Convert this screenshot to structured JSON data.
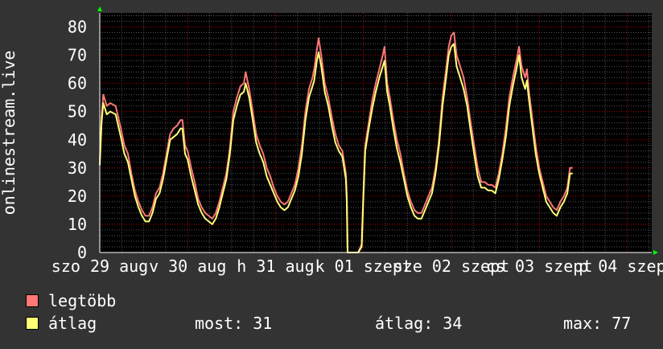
{
  "chart_data": {
    "type": "line",
    "ylabel": "onlinestream.live",
    "ylim": [
      0,
      85
    ],
    "yticks": [
      0,
      10,
      20,
      30,
      40,
      50,
      60,
      70,
      80
    ],
    "xticks": [
      {
        "label": "szo 29 aug",
        "day": 0
      },
      {
        "label": "v 30 aug",
        "day": 1
      },
      {
        "label": "h 31 aug",
        "day": 2
      },
      {
        "label": "k 01 szept",
        "day": 3
      },
      {
        "label": "sze 02 szept",
        "day": 4
      },
      {
        "label": "cs 03 szept",
        "day": 5
      },
      {
        "label": "p 04 szept",
        "day": 6
      }
    ],
    "xlim_days": [
      0,
      6.28
    ],
    "grid": true,
    "series": [
      {
        "name": "legtöbb",
        "color": "#ff7777",
        "points": [
          [
            0.0,
            33
          ],
          [
            0.02,
            48
          ],
          [
            0.04,
            56
          ],
          [
            0.08,
            52
          ],
          [
            0.12,
            53
          ],
          [
            0.18,
            52
          ],
          [
            0.24,
            44
          ],
          [
            0.28,
            38
          ],
          [
            0.32,
            35
          ],
          [
            0.36,
            28
          ],
          [
            0.4,
            22
          ],
          [
            0.44,
            18
          ],
          [
            0.48,
            15
          ],
          [
            0.52,
            13
          ],
          [
            0.56,
            13
          ],
          [
            0.6,
            16
          ],
          [
            0.64,
            21
          ],
          [
            0.68,
            23
          ],
          [
            0.72,
            28
          ],
          [
            0.76,
            35
          ],
          [
            0.8,
            42
          ],
          [
            0.84,
            44
          ],
          [
            0.88,
            45
          ],
          [
            0.92,
            47
          ],
          [
            0.94,
            47
          ],
          [
            0.97,
            38
          ],
          [
            1.0,
            36
          ],
          [
            1.04,
            30
          ],
          [
            1.08,
            25
          ],
          [
            1.12,
            19
          ],
          [
            1.16,
            16
          ],
          [
            1.2,
            14
          ],
          [
            1.24,
            13
          ],
          [
            1.28,
            12
          ],
          [
            1.32,
            14
          ],
          [
            1.36,
            18
          ],
          [
            1.4,
            23
          ],
          [
            1.44,
            28
          ],
          [
            1.48,
            37
          ],
          [
            1.52,
            50
          ],
          [
            1.56,
            55
          ],
          [
            1.6,
            59
          ],
          [
            1.64,
            60
          ],
          [
            1.66,
            64
          ],
          [
            1.7,
            58
          ],
          [
            1.74,
            50
          ],
          [
            1.78,
            42
          ],
          [
            1.82,
            38
          ],
          [
            1.86,
            35
          ],
          [
            1.9,
            30
          ],
          [
            1.94,
            27
          ],
          [
            1.98,
            23
          ],
          [
            2.02,
            20
          ],
          [
            2.06,
            18
          ],
          [
            2.1,
            17
          ],
          [
            2.14,
            18
          ],
          [
            2.18,
            21
          ],
          [
            2.22,
            24
          ],
          [
            2.26,
            30
          ],
          [
            2.3,
            38
          ],
          [
            2.34,
            50
          ],
          [
            2.38,
            58
          ],
          [
            2.42,
            62
          ],
          [
            2.44,
            65
          ],
          [
            2.47,
            72
          ],
          [
            2.49,
            76
          ],
          [
            2.52,
            70
          ],
          [
            2.56,
            60
          ],
          [
            2.6,
            55
          ],
          [
            2.64,
            48
          ],
          [
            2.68,
            42
          ],
          [
            2.72,
            38
          ],
          [
            2.76,
            36
          ],
          [
            2.78,
            32
          ],
          [
            2.8,
            28
          ],
          [
            2.81,
            20
          ],
          [
            2.82,
            0
          ],
          [
            2.94,
            0
          ],
          [
            2.98,
            3
          ],
          [
            3.0,
            22
          ],
          [
            3.02,
            38
          ],
          [
            3.06,
            46
          ],
          [
            3.1,
            54
          ],
          [
            3.14,
            60
          ],
          [
            3.18,
            65
          ],
          [
            3.22,
            70
          ],
          [
            3.24,
            73
          ],
          [
            3.27,
            60
          ],
          [
            3.3,
            55
          ],
          [
            3.34,
            47
          ],
          [
            3.38,
            40
          ],
          [
            3.42,
            35
          ],
          [
            3.46,
            28
          ],
          [
            3.5,
            22
          ],
          [
            3.54,
            18
          ],
          [
            3.58,
            15
          ],
          [
            3.62,
            14
          ],
          [
            3.66,
            14
          ],
          [
            3.7,
            17
          ],
          [
            3.74,
            20
          ],
          [
            3.78,
            23
          ],
          [
            3.82,
            30
          ],
          [
            3.86,
            40
          ],
          [
            3.9,
            55
          ],
          [
            3.94,
            65
          ],
          [
            3.97,
            73
          ],
          [
            4.0,
            77
          ],
          [
            4.03,
            78
          ],
          [
            4.06,
            70
          ],
          [
            4.1,
            66
          ],
          [
            4.14,
            62
          ],
          [
            4.18,
            55
          ],
          [
            4.22,
            46
          ],
          [
            4.26,
            38
          ],
          [
            4.3,
            30
          ],
          [
            4.34,
            25
          ],
          [
            4.38,
            25
          ],
          [
            4.42,
            24
          ],
          [
            4.46,
            24
          ],
          [
            4.5,
            23
          ],
          [
            4.54,
            28
          ],
          [
            4.58,
            35
          ],
          [
            4.62,
            44
          ],
          [
            4.66,
            55
          ],
          [
            4.7,
            62
          ],
          [
            4.74,
            68
          ],
          [
            4.77,
            73
          ],
          [
            4.8,
            66
          ],
          [
            4.84,
            62
          ],
          [
            4.86,
            65
          ],
          [
            4.88,
            58
          ],
          [
            4.92,
            48
          ],
          [
            4.96,
            38
          ],
          [
            5.0,
            30
          ],
          [
            5.04,
            25
          ],
          [
            5.08,
            20
          ],
          [
            5.12,
            18
          ],
          [
            5.16,
            16
          ],
          [
            5.2,
            15
          ],
          [
            5.24,
            18
          ],
          [
            5.28,
            20
          ],
          [
            5.32,
            23
          ],
          [
            5.35,
            30
          ],
          [
            5.38,
            30
          ]
        ]
      },
      {
        "name": "átlag",
        "color": "#ffff77",
        "points": [
          [
            0.0,
            31
          ],
          [
            0.02,
            46
          ],
          [
            0.04,
            53
          ],
          [
            0.08,
            49
          ],
          [
            0.12,
            50
          ],
          [
            0.18,
            49
          ],
          [
            0.24,
            41
          ],
          [
            0.28,
            35
          ],
          [
            0.32,
            32
          ],
          [
            0.36,
            26
          ],
          [
            0.4,
            20
          ],
          [
            0.44,
            16
          ],
          [
            0.48,
            13
          ],
          [
            0.52,
            11
          ],
          [
            0.56,
            11
          ],
          [
            0.6,
            14
          ],
          [
            0.64,
            19
          ],
          [
            0.68,
            21
          ],
          [
            0.72,
            26
          ],
          [
            0.76,
            33
          ],
          [
            0.8,
            40
          ],
          [
            0.84,
            41
          ],
          [
            0.88,
            42
          ],
          [
            0.92,
            44
          ],
          [
            0.94,
            44
          ],
          [
            0.97,
            35
          ],
          [
            1.0,
            33
          ],
          [
            1.04,
            27
          ],
          [
            1.08,
            22
          ],
          [
            1.12,
            17
          ],
          [
            1.16,
            14
          ],
          [
            1.2,
            12
          ],
          [
            1.24,
            11
          ],
          [
            1.28,
            10
          ],
          [
            1.32,
            12
          ],
          [
            1.36,
            16
          ],
          [
            1.4,
            21
          ],
          [
            1.44,
            26
          ],
          [
            1.48,
            35
          ],
          [
            1.52,
            47
          ],
          [
            1.56,
            52
          ],
          [
            1.6,
            56
          ],
          [
            1.64,
            57
          ],
          [
            1.66,
            60
          ],
          [
            1.7,
            55
          ],
          [
            1.74,
            47
          ],
          [
            1.78,
            39
          ],
          [
            1.82,
            35
          ],
          [
            1.86,
            32
          ],
          [
            1.9,
            27
          ],
          [
            1.94,
            24
          ],
          [
            1.98,
            21
          ],
          [
            2.02,
            18
          ],
          [
            2.06,
            16
          ],
          [
            2.1,
            15
          ],
          [
            2.14,
            16
          ],
          [
            2.18,
            19
          ],
          [
            2.22,
            22
          ],
          [
            2.26,
            27
          ],
          [
            2.3,
            35
          ],
          [
            2.34,
            47
          ],
          [
            2.38,
            55
          ],
          [
            2.42,
            59
          ],
          [
            2.44,
            61
          ],
          [
            2.47,
            68
          ],
          [
            2.49,
            71
          ],
          [
            2.52,
            66
          ],
          [
            2.56,
            57
          ],
          [
            2.6,
            52
          ],
          [
            2.64,
            45
          ],
          [
            2.68,
            39
          ],
          [
            2.72,
            36
          ],
          [
            2.76,
            34
          ],
          [
            2.78,
            30
          ],
          [
            2.8,
            26
          ],
          [
            2.81,
            18
          ],
          [
            2.82,
            0
          ],
          [
            2.94,
            0
          ],
          [
            2.98,
            2
          ],
          [
            3.0,
            20
          ],
          [
            3.02,
            36
          ],
          [
            3.06,
            44
          ],
          [
            3.1,
            51
          ],
          [
            3.14,
            57
          ],
          [
            3.18,
            62
          ],
          [
            3.22,
            66
          ],
          [
            3.24,
            68
          ],
          [
            3.27,
            57
          ],
          [
            3.3,
            52
          ],
          [
            3.34,
            44
          ],
          [
            3.38,
            37
          ],
          [
            3.42,
            32
          ],
          [
            3.46,
            26
          ],
          [
            3.5,
            20
          ],
          [
            3.54,
            16
          ],
          [
            3.58,
            13
          ],
          [
            3.62,
            12
          ],
          [
            3.66,
            12
          ],
          [
            3.7,
            15
          ],
          [
            3.74,
            18
          ],
          [
            3.78,
            21
          ],
          [
            3.82,
            28
          ],
          [
            3.86,
            38
          ],
          [
            3.9,
            52
          ],
          [
            3.94,
            62
          ],
          [
            3.97,
            70
          ],
          [
            4.0,
            73
          ],
          [
            4.03,
            74
          ],
          [
            4.06,
            66
          ],
          [
            4.1,
            62
          ],
          [
            4.14,
            58
          ],
          [
            4.18,
            52
          ],
          [
            4.22,
            43
          ],
          [
            4.26,
            35
          ],
          [
            4.3,
            27
          ],
          [
            4.34,
            23
          ],
          [
            4.38,
            23
          ],
          [
            4.42,
            22
          ],
          [
            4.46,
            22
          ],
          [
            4.5,
            21
          ],
          [
            4.54,
            26
          ],
          [
            4.58,
            33
          ],
          [
            4.62,
            41
          ],
          [
            4.66,
            52
          ],
          [
            4.7,
            59
          ],
          [
            4.74,
            65
          ],
          [
            4.77,
            70
          ],
          [
            4.8,
            62
          ],
          [
            4.84,
            58
          ],
          [
            4.86,
            61
          ],
          [
            4.88,
            55
          ],
          [
            4.92,
            45
          ],
          [
            4.96,
            35
          ],
          [
            5.0,
            28
          ],
          [
            5.04,
            23
          ],
          [
            5.08,
            18
          ],
          [
            5.12,
            16
          ],
          [
            5.16,
            14
          ],
          [
            5.2,
            13
          ],
          [
            5.24,
            16
          ],
          [
            5.28,
            18
          ],
          [
            5.32,
            21
          ],
          [
            5.35,
            28
          ],
          [
            5.38,
            28
          ]
        ]
      }
    ]
  },
  "legend": {
    "items": [
      {
        "label": "legtöbb",
        "color": "#ff7777"
      },
      {
        "label": "átlag",
        "color": "#ffff77"
      }
    ],
    "stats": {
      "now": "most: 31",
      "avg": "átlag: 34",
      "max": "max: 77"
    }
  },
  "colors": {
    "background": "#333333",
    "plot_background": "#000000",
    "grid_minor": "#555555",
    "grid_major": "#b00000",
    "axis": "#ffffff",
    "arrow": "#00ff00"
  }
}
